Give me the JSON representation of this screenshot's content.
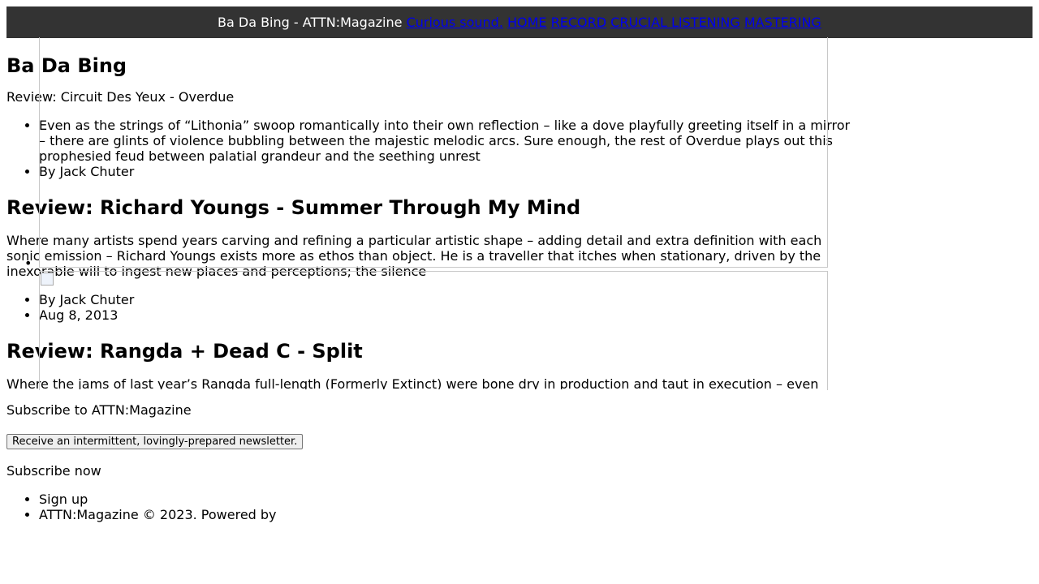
{
  "topbar": {
    "site_title": "Ba Da Bing - ATTN:Magazine",
    "links": [
      "Curious sound.",
      "HOME",
      "RECORD",
      "CRUCIAL LISTENING",
      "MASTERING"
    ]
  },
  "main": {
    "page_heading": "Ba Da Bing",
    "review1": {
      "title": "Review: Circuit Des Yeux - Overdue",
      "excerpt": "Even as the strings of “Lithonia” swoop romantically into their own reflection – like a dove playfully greeting itself in a mirror – there are glints of violence bubbling between the majestic melodic arcs. Sure enough, the rest of Overdue plays out this prophesied feud between palatial grandeur and the seething unrest",
      "author": "By Jack Chuter"
    },
    "review2": {
      "title": "Review: Richard Youngs - Summer Through My Mind",
      "excerpt": "Where many artists spend years carving and refining a particular artistic shape – adding detail and extra definition with each sonic emission – Richard Youngs exists more as ethos than object. He is a traveller that itches when stationary, driven by the inexorable will to ingest new places and perceptions; the silence",
      "author": "By Jack Chuter",
      "date": "Aug 8, 2013"
    },
    "review3": {
      "title": "Review: Rangda + Dead C - Split",
      "excerpt": "Where the jams of last year’s Rangda full-length (Formerly Extinct) were bone dry in production and taut in execution – even"
    }
  },
  "footer": {
    "subscribe_heading": "Subscribe to ATTN:Magazine",
    "newsletter_button": "Receive an intermittent, lovingly-prepared newsletter.",
    "subscribe_now": "Subscribe now",
    "signup": "Sign up",
    "copyright": "ATTN:Magazine © 2023. Powered by"
  }
}
